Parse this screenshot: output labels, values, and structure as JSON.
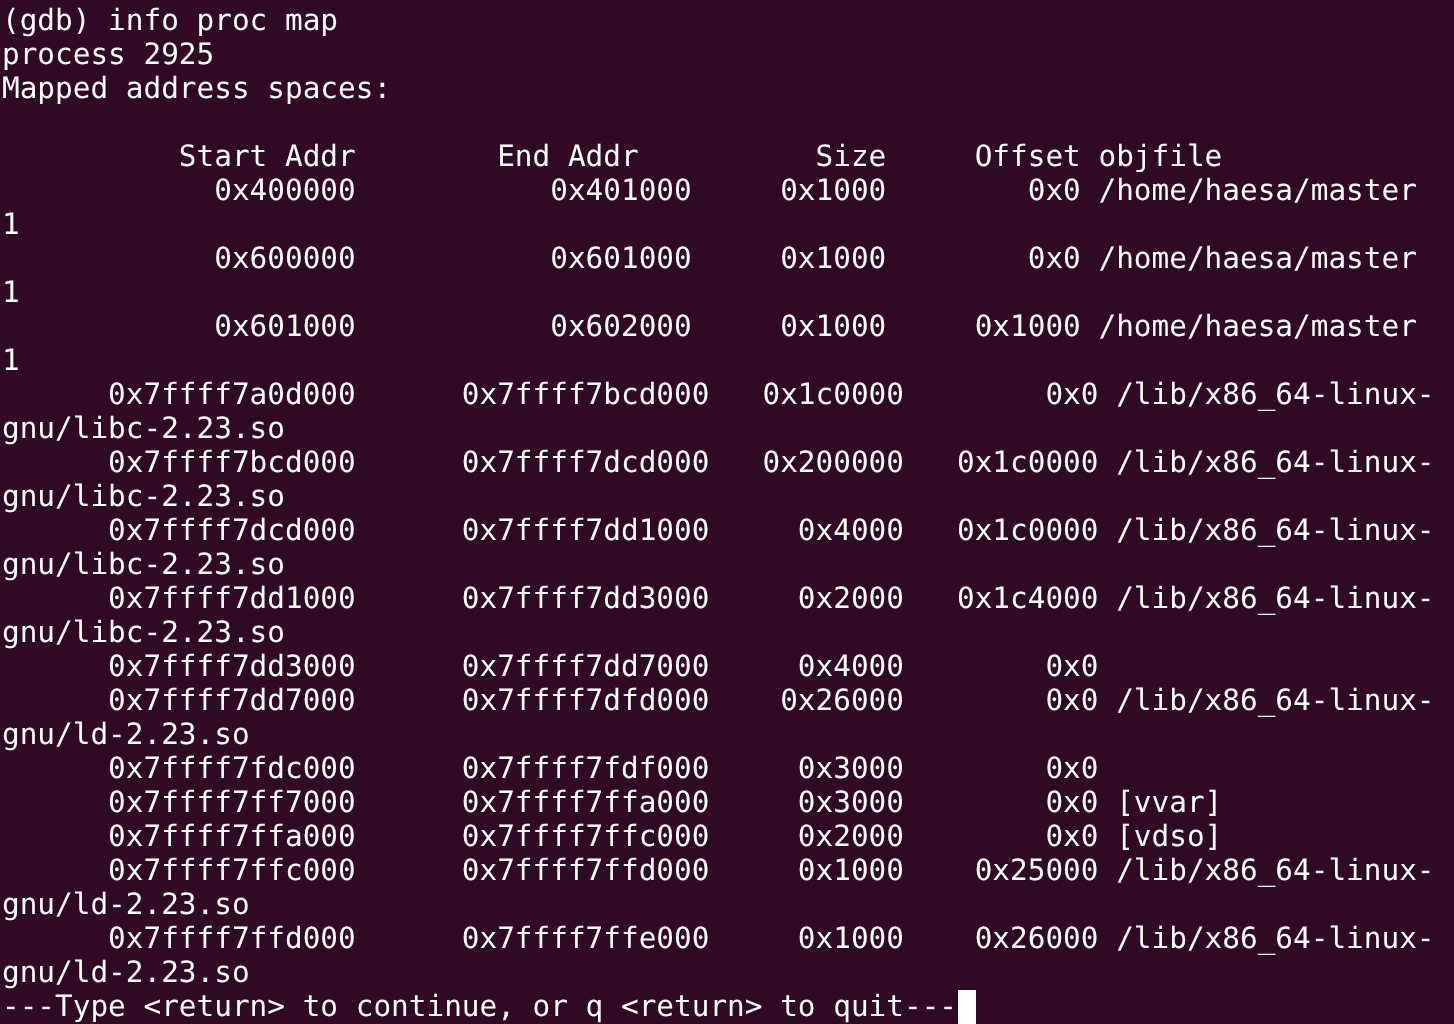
{
  "terminal": {
    "lines": [
      {
        "kind": "text",
        "text": "(gdb) info proc map"
      },
      {
        "kind": "text",
        "text": "process 2925"
      },
      {
        "kind": "text",
        "text": "Mapped address spaces:"
      },
      {
        "kind": "blank"
      },
      {
        "kind": "text",
        "text": "          Start Addr        End Addr          Size     Offset objfile"
      },
      {
        "kind": "text",
        "text": "            0x400000           0x401000     0x1000        0x0 /home/haesa/master"
      },
      {
        "kind": "text",
        "text": "1"
      },
      {
        "kind": "text",
        "text": "            0x600000           0x601000     0x1000        0x0 /home/haesa/master"
      },
      {
        "kind": "text",
        "text": "1"
      },
      {
        "kind": "text",
        "text": "            0x601000           0x602000     0x1000     0x1000 /home/haesa/master"
      },
      {
        "kind": "text",
        "text": "1"
      },
      {
        "kind": "text",
        "text": "      0x7ffff7a0d000      0x7ffff7bcd000   0x1c0000        0x0 /lib/x86_64-linux-"
      },
      {
        "kind": "text",
        "text": "gnu/libc-2.23.so"
      },
      {
        "kind": "text",
        "text": "      0x7ffff7bcd000      0x7ffff7dcd000   0x200000   0x1c0000 /lib/x86_64-linux-"
      },
      {
        "kind": "text",
        "text": "gnu/libc-2.23.so"
      },
      {
        "kind": "text",
        "text": "      0x7ffff7dcd000      0x7ffff7dd1000     0x4000   0x1c0000 /lib/x86_64-linux-"
      },
      {
        "kind": "text",
        "text": "gnu/libc-2.23.so"
      },
      {
        "kind": "text",
        "text": "      0x7ffff7dd1000      0x7ffff7dd3000     0x2000   0x1c4000 /lib/x86_64-linux-"
      },
      {
        "kind": "text",
        "text": "gnu/libc-2.23.so"
      },
      {
        "kind": "text",
        "text": "      0x7ffff7dd3000      0x7ffff7dd7000     0x4000        0x0"
      },
      {
        "kind": "text",
        "text": "      0x7ffff7dd7000      0x7ffff7dfd000    0x26000        0x0 /lib/x86_64-linux-"
      },
      {
        "kind": "text",
        "text": "gnu/ld-2.23.so"
      },
      {
        "kind": "text",
        "text": "      0x7ffff7fdc000      0x7ffff7fdf000     0x3000        0x0"
      },
      {
        "kind": "text",
        "text": "      0x7ffff7ff7000      0x7ffff7ffa000     0x3000        0x0 [vvar]"
      },
      {
        "kind": "text",
        "text": "      0x7ffff7ffa000      0x7ffff7ffc000     0x2000        0x0 [vdso]"
      },
      {
        "kind": "text",
        "text": "      0x7ffff7ffc000      0x7ffff7ffd000     0x1000    0x25000 /lib/x86_64-linux-"
      },
      {
        "kind": "text",
        "text": "gnu/ld-2.23.so"
      },
      {
        "kind": "text",
        "text": "      0x7ffff7ffd000      0x7ffff7ffe000     0x1000    0x26000 /lib/x86_64-linux-"
      },
      {
        "kind": "text",
        "text": "gnu/ld-2.23.so"
      }
    ],
    "prompt": {
      "text": "---Type <return> to continue, or q <return> to quit---",
      "cursor": true
    }
  }
}
